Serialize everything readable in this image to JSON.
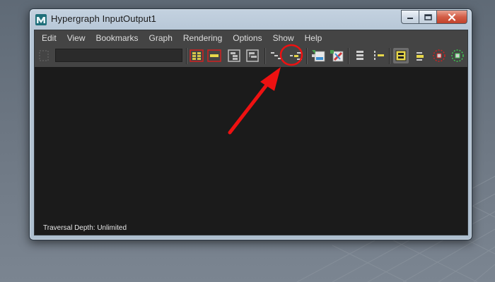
{
  "window": {
    "title": "Hypergraph InputOutput1",
    "caption_buttons": [
      "minimize",
      "maximize",
      "close"
    ]
  },
  "menubar": {
    "items": [
      "Edit",
      "View",
      "Bookmarks",
      "Graph",
      "Rendering",
      "Options",
      "Show",
      "Help"
    ]
  },
  "toolbar": {
    "field_value": "",
    "icons": [
      "frame-all-icon",
      "frame-selection-icon",
      "frame-hierarchy-icon",
      "frame-branch-icon",
      "scene-hierarchy-icon",
      "input-output-connections-icon",
      "clear-view-icon",
      "graph-materials-icon",
      "layout-icon",
      "next-level-icon",
      "toggle-swatch-icon",
      "simple-mode-icon",
      "input-connections-icon",
      "output-connections-icon"
    ]
  },
  "status": {
    "text": "Traversal Depth: Unlimited"
  },
  "annotation": {
    "highlighted_button": "input-output-connections-icon",
    "color": "#ee1111"
  }
}
